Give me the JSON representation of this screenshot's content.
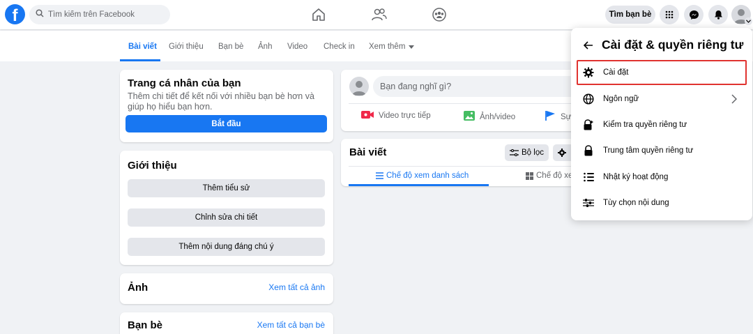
{
  "topbar": {
    "search_placeholder": "Tìm kiếm trên Facebook",
    "find_friends_label": "Tìm bạn bè",
    "brand_color": "#1877f2",
    "icons": [
      "facebook-logo",
      "search-icon",
      "home-icon",
      "friends-icon",
      "groups-icon",
      "menu-grid-icon",
      "messenger-icon",
      "notifications-icon",
      "account-avatar"
    ]
  },
  "profile_tabs": {
    "items": [
      "Bài viết",
      "Giới thiệu",
      "Bạn bè",
      "Ảnh",
      "Video",
      "Check in"
    ],
    "more": "Xem thêm",
    "active": "Bài viết"
  },
  "left_column": {
    "profile_card": {
      "title": "Trang cá nhân của bạn",
      "description": "Thêm chi tiết để kết nối với nhiều bạn bè hơn và giúp họ hiểu bạn hơn.",
      "button": "Bắt đầu"
    },
    "intro_card": {
      "title": "Giới thiệu",
      "buttons": [
        "Thêm tiểu sử",
        "Chỉnh sửa chi tiết",
        "Thêm nội dung đáng chú ý"
      ]
    },
    "photos_card": {
      "title": "Ảnh",
      "link": "Xem tất cả ảnh"
    },
    "friends_card": {
      "title": "Bạn bè",
      "link": "Xem tất cả bạn bè"
    }
  },
  "composer": {
    "placeholder": "Bạn đang nghĩ gì?",
    "actions": [
      "Video trực tiếp",
      "Ảnh/video",
      "Sự"
    ]
  },
  "posts_card": {
    "title": "Bài viết",
    "filter_button": "Bộ lọc",
    "list_view": "Chế độ xem danh sách",
    "grid_view": "Chế độ xem"
  },
  "dropdown": {
    "title": "Cài đặt & quyền riêng tư",
    "items": [
      {
        "label": "Cài đặt",
        "icon": "gear-icon",
        "highlighted": true
      },
      {
        "label": "Ngôn ngữ",
        "icon": "globe-icon",
        "has_arrow": true
      },
      {
        "label": "Kiểm tra quyền riêng tư",
        "icon": "lock-plus-icon"
      },
      {
        "label": "Trung tâm quyền riêng tư",
        "icon": "lock-icon"
      },
      {
        "label": "Nhật ký hoạt động",
        "icon": "activity-list-icon"
      },
      {
        "label": "Tùy chọn nội dung",
        "icon": "sliders-icon"
      }
    ],
    "highlight_color": "#e0322f"
  }
}
